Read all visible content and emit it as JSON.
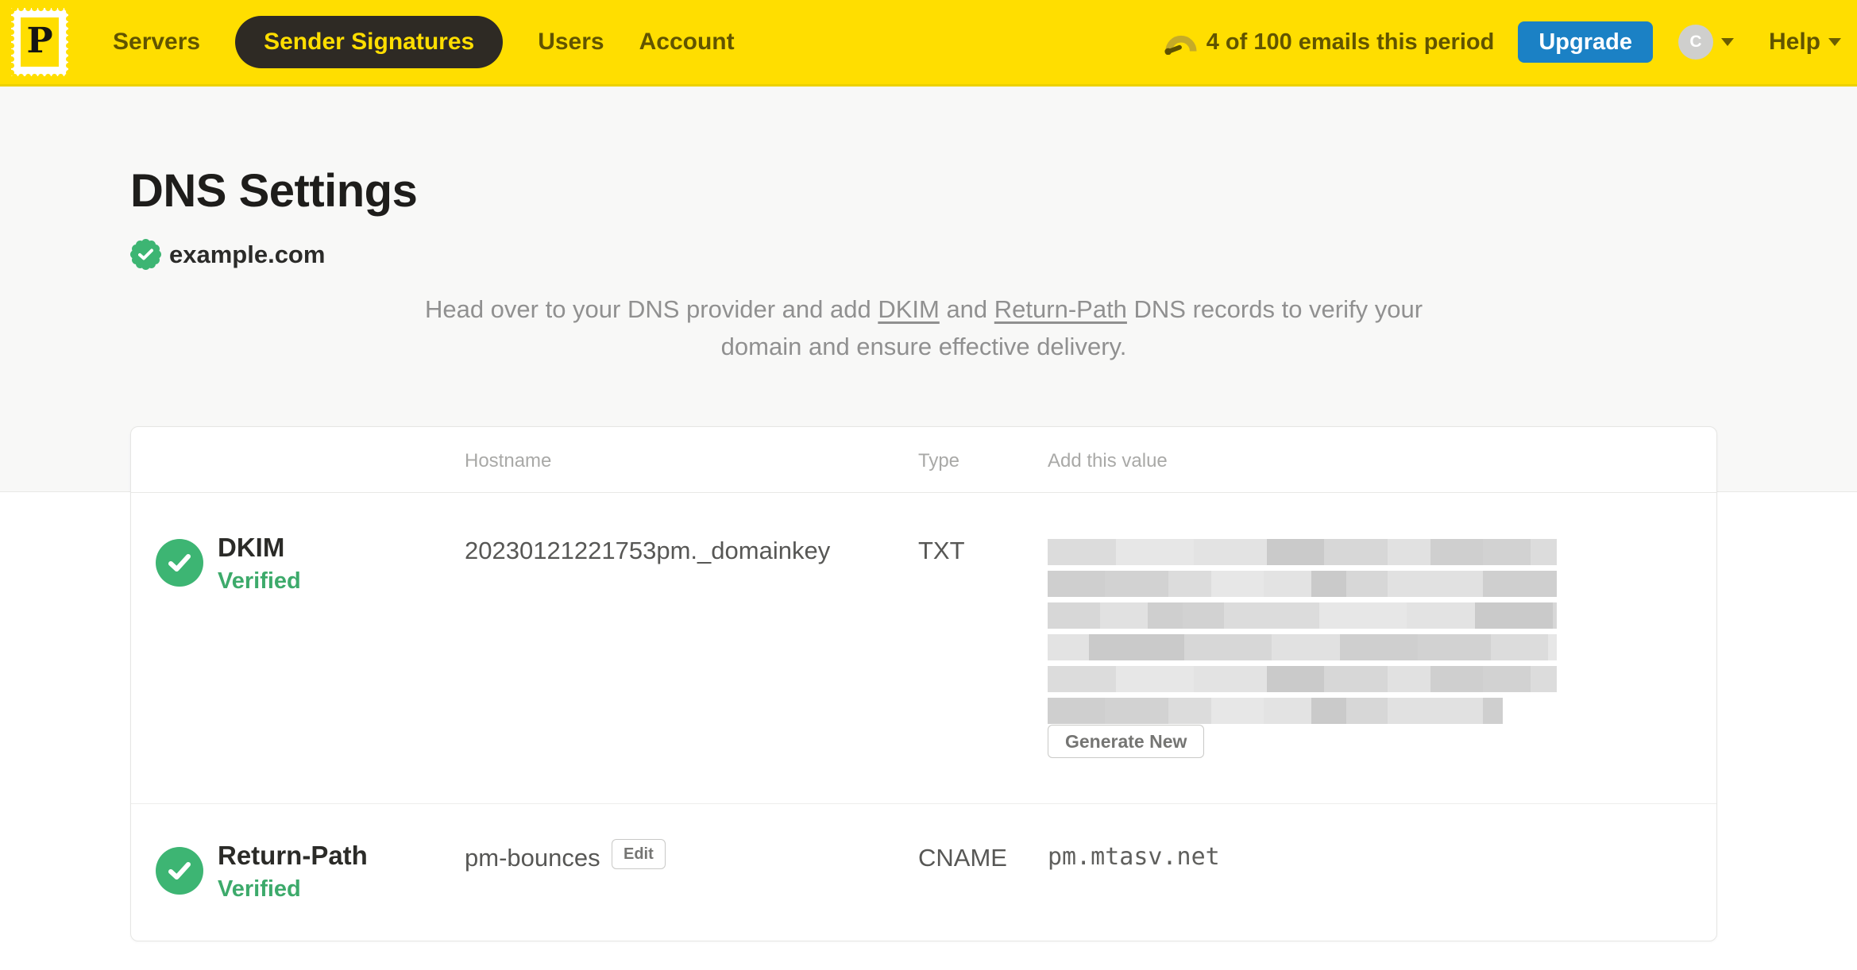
{
  "colors": {
    "brand_yellow": "#FFDE00",
    "navbar_border": "#EDD100",
    "nav_link_text": "#615400",
    "active_pill_bg": "#2E2A24",
    "upgrade_blue": "#1B81C5",
    "verified_green": "#3DB573",
    "page_bg": "#F8F8F7",
    "card_border": "#E6E6E4",
    "heading_text": "#1E1D1B",
    "muted_text": "#909090"
  },
  "navbar": {
    "logo_letter": "P",
    "items": [
      {
        "label": "Servers",
        "active": false
      },
      {
        "label": "Sender Signatures",
        "active": true
      },
      {
        "label": "Users",
        "active": false
      },
      {
        "label": "Account",
        "active": false
      }
    ],
    "usage_text": "4 of 100 emails this period",
    "upgrade_label": "Upgrade",
    "avatar_initial": "C",
    "help_label": "Help"
  },
  "page": {
    "title": "DNS Settings",
    "domain": "example.com",
    "domain_verified": true,
    "intro": {
      "seg1": "Head over to your DNS provider and add ",
      "dkim_link": "DKIM",
      "seg2": " and ",
      "return_path_link": "Return-Path",
      "seg3": " DNS records to verify your domain and ensure effective delivery."
    }
  },
  "table": {
    "headers": {
      "hostname": "Hostname",
      "type": "Type",
      "value": "Add this value"
    },
    "rows": [
      {
        "name": "DKIM",
        "status": "Verified",
        "hostname": "20230121221753pm._domainkey",
        "type": "TXT",
        "value_redacted": true,
        "action_label": "Generate New"
      },
      {
        "name": "Return-Path",
        "status": "Verified",
        "hostname": "pm-bounces",
        "edit_label": "Edit",
        "type": "CNAME",
        "value": "pm.mtasv.net"
      }
    ]
  }
}
